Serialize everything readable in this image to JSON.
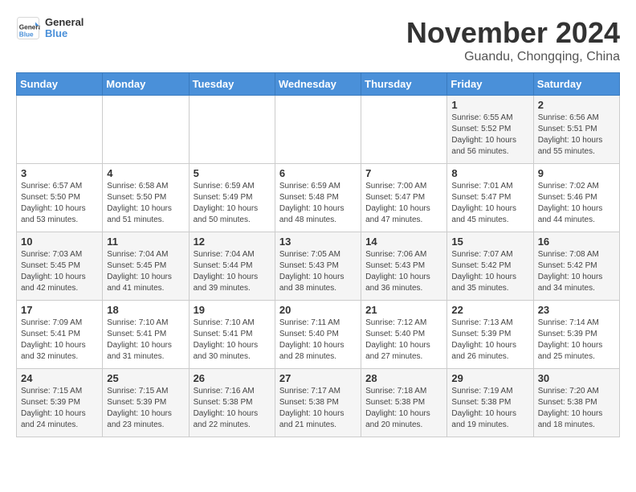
{
  "logo": {
    "text_general": "General",
    "text_blue": "Blue"
  },
  "title": "November 2024",
  "subtitle": "Guandu, Chongqing, China",
  "days_of_week": [
    "Sunday",
    "Monday",
    "Tuesday",
    "Wednesday",
    "Thursday",
    "Friday",
    "Saturday"
  ],
  "weeks": [
    [
      {
        "day": "",
        "info": ""
      },
      {
        "day": "",
        "info": ""
      },
      {
        "day": "",
        "info": ""
      },
      {
        "day": "",
        "info": ""
      },
      {
        "day": "",
        "info": ""
      },
      {
        "day": "1",
        "info": "Sunrise: 6:55 AM\nSunset: 5:52 PM\nDaylight: 10 hours\nand 56 minutes."
      },
      {
        "day": "2",
        "info": "Sunrise: 6:56 AM\nSunset: 5:51 PM\nDaylight: 10 hours\nand 55 minutes."
      }
    ],
    [
      {
        "day": "3",
        "info": "Sunrise: 6:57 AM\nSunset: 5:50 PM\nDaylight: 10 hours\nand 53 minutes."
      },
      {
        "day": "4",
        "info": "Sunrise: 6:58 AM\nSunset: 5:50 PM\nDaylight: 10 hours\nand 51 minutes."
      },
      {
        "day": "5",
        "info": "Sunrise: 6:59 AM\nSunset: 5:49 PM\nDaylight: 10 hours\nand 50 minutes."
      },
      {
        "day": "6",
        "info": "Sunrise: 6:59 AM\nSunset: 5:48 PM\nDaylight: 10 hours\nand 48 minutes."
      },
      {
        "day": "7",
        "info": "Sunrise: 7:00 AM\nSunset: 5:47 PM\nDaylight: 10 hours\nand 47 minutes."
      },
      {
        "day": "8",
        "info": "Sunrise: 7:01 AM\nSunset: 5:47 PM\nDaylight: 10 hours\nand 45 minutes."
      },
      {
        "day": "9",
        "info": "Sunrise: 7:02 AM\nSunset: 5:46 PM\nDaylight: 10 hours\nand 44 minutes."
      }
    ],
    [
      {
        "day": "10",
        "info": "Sunrise: 7:03 AM\nSunset: 5:45 PM\nDaylight: 10 hours\nand 42 minutes."
      },
      {
        "day": "11",
        "info": "Sunrise: 7:04 AM\nSunset: 5:45 PM\nDaylight: 10 hours\nand 41 minutes."
      },
      {
        "day": "12",
        "info": "Sunrise: 7:04 AM\nSunset: 5:44 PM\nDaylight: 10 hours\nand 39 minutes."
      },
      {
        "day": "13",
        "info": "Sunrise: 7:05 AM\nSunset: 5:43 PM\nDaylight: 10 hours\nand 38 minutes."
      },
      {
        "day": "14",
        "info": "Sunrise: 7:06 AM\nSunset: 5:43 PM\nDaylight: 10 hours\nand 36 minutes."
      },
      {
        "day": "15",
        "info": "Sunrise: 7:07 AM\nSunset: 5:42 PM\nDaylight: 10 hours\nand 35 minutes."
      },
      {
        "day": "16",
        "info": "Sunrise: 7:08 AM\nSunset: 5:42 PM\nDaylight: 10 hours\nand 34 minutes."
      }
    ],
    [
      {
        "day": "17",
        "info": "Sunrise: 7:09 AM\nSunset: 5:41 PM\nDaylight: 10 hours\nand 32 minutes."
      },
      {
        "day": "18",
        "info": "Sunrise: 7:10 AM\nSunset: 5:41 PM\nDaylight: 10 hours\nand 31 minutes."
      },
      {
        "day": "19",
        "info": "Sunrise: 7:10 AM\nSunset: 5:41 PM\nDaylight: 10 hours\nand 30 minutes."
      },
      {
        "day": "20",
        "info": "Sunrise: 7:11 AM\nSunset: 5:40 PM\nDaylight: 10 hours\nand 28 minutes."
      },
      {
        "day": "21",
        "info": "Sunrise: 7:12 AM\nSunset: 5:40 PM\nDaylight: 10 hours\nand 27 minutes."
      },
      {
        "day": "22",
        "info": "Sunrise: 7:13 AM\nSunset: 5:39 PM\nDaylight: 10 hours\nand 26 minutes."
      },
      {
        "day": "23",
        "info": "Sunrise: 7:14 AM\nSunset: 5:39 PM\nDaylight: 10 hours\nand 25 minutes."
      }
    ],
    [
      {
        "day": "24",
        "info": "Sunrise: 7:15 AM\nSunset: 5:39 PM\nDaylight: 10 hours\nand 24 minutes."
      },
      {
        "day": "25",
        "info": "Sunrise: 7:15 AM\nSunset: 5:39 PM\nDaylight: 10 hours\nand 23 minutes."
      },
      {
        "day": "26",
        "info": "Sunrise: 7:16 AM\nSunset: 5:38 PM\nDaylight: 10 hours\nand 22 minutes."
      },
      {
        "day": "27",
        "info": "Sunrise: 7:17 AM\nSunset: 5:38 PM\nDaylight: 10 hours\nand 21 minutes."
      },
      {
        "day": "28",
        "info": "Sunrise: 7:18 AM\nSunset: 5:38 PM\nDaylight: 10 hours\nand 20 minutes."
      },
      {
        "day": "29",
        "info": "Sunrise: 7:19 AM\nSunset: 5:38 PM\nDaylight: 10 hours\nand 19 minutes."
      },
      {
        "day": "30",
        "info": "Sunrise: 7:20 AM\nSunset: 5:38 PM\nDaylight: 10 hours\nand 18 minutes."
      }
    ]
  ]
}
